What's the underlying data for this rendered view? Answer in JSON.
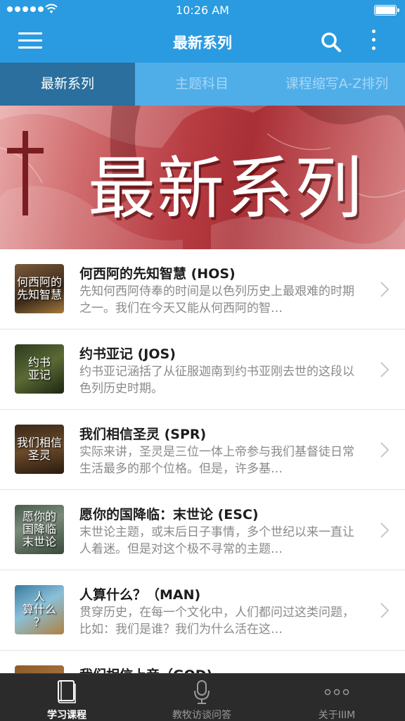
{
  "status_bar": {
    "time": "10:26 AM",
    "signal_icon": "cellular-signal-icon",
    "wifi_icon": "wifi-icon",
    "battery_icon": "battery-icon",
    "battery_level": 1.0
  },
  "nav": {
    "title": "最新系列",
    "menu_icon": "hamburger-menu-icon",
    "search_icon": "search-icon",
    "more_icon": "more-vertical-icon"
  },
  "tabs": [
    {
      "label": "最新系列",
      "active": true
    },
    {
      "label": "主题科目",
      "active": false
    },
    {
      "label": "课程缩写A-Z排列",
      "active": false
    }
  ],
  "banner": {
    "title": "最新系列"
  },
  "courses": [
    {
      "thumb_text": "何西阿的\n先知智慧",
      "title": "何西阿的先知智慧 (HOS)",
      "desc": "先知何西阿侍奉的时间是以色列历史上最艰难的时期之一。我们在今天又能从何西阿的智…"
    },
    {
      "thumb_text": "约书\n亚记",
      "title": "约书亚记 (JOS)",
      "desc": "约书亚记涵括了从征服迦南到约书亚刚去世的这段以色列历史时期。"
    },
    {
      "thumb_text": "我们相信\n圣灵",
      "title": "我们相信圣灵 (SPR)",
      "desc": "实际来讲，圣灵是三位一体上帝参与我们基督徒日常生活最多的那个位格。但是，许多基…"
    },
    {
      "thumb_text": "愿你的\n国降临\n末世论",
      "title": "愿你的国降临：末世论 (ESC)",
      "desc": "末世论主题，或末后日子事情，多个世纪以来一直让人着迷。但是对这个极不寻常的主题…"
    },
    {
      "thumb_text": "人\n算什么\n？",
      "title": "人算什么？（MAN)",
      "desc": "贯穿历史，在每一个文化中，人们都问过这类问题，比如：我们是谁？我们为什么活在这…"
    },
    {
      "thumb_text": "",
      "title": "我们相信上帝（GOD)",
      "desc": ""
    }
  ],
  "bottom_tabs": [
    {
      "label": "学习课程",
      "icon": "book-icon",
      "active": true
    },
    {
      "label": "教牧访谈问答",
      "icon": "microphone-icon",
      "active": false
    },
    {
      "label": "关于IIIM",
      "icon": "more-horizontal-icon",
      "active": false
    }
  ],
  "colors": {
    "nav_blue": "#2a9be0",
    "tab_bar_blue": "#4faee8",
    "active_tab": "#2a6f9d",
    "bottom_bar": "#2b2b2b"
  }
}
